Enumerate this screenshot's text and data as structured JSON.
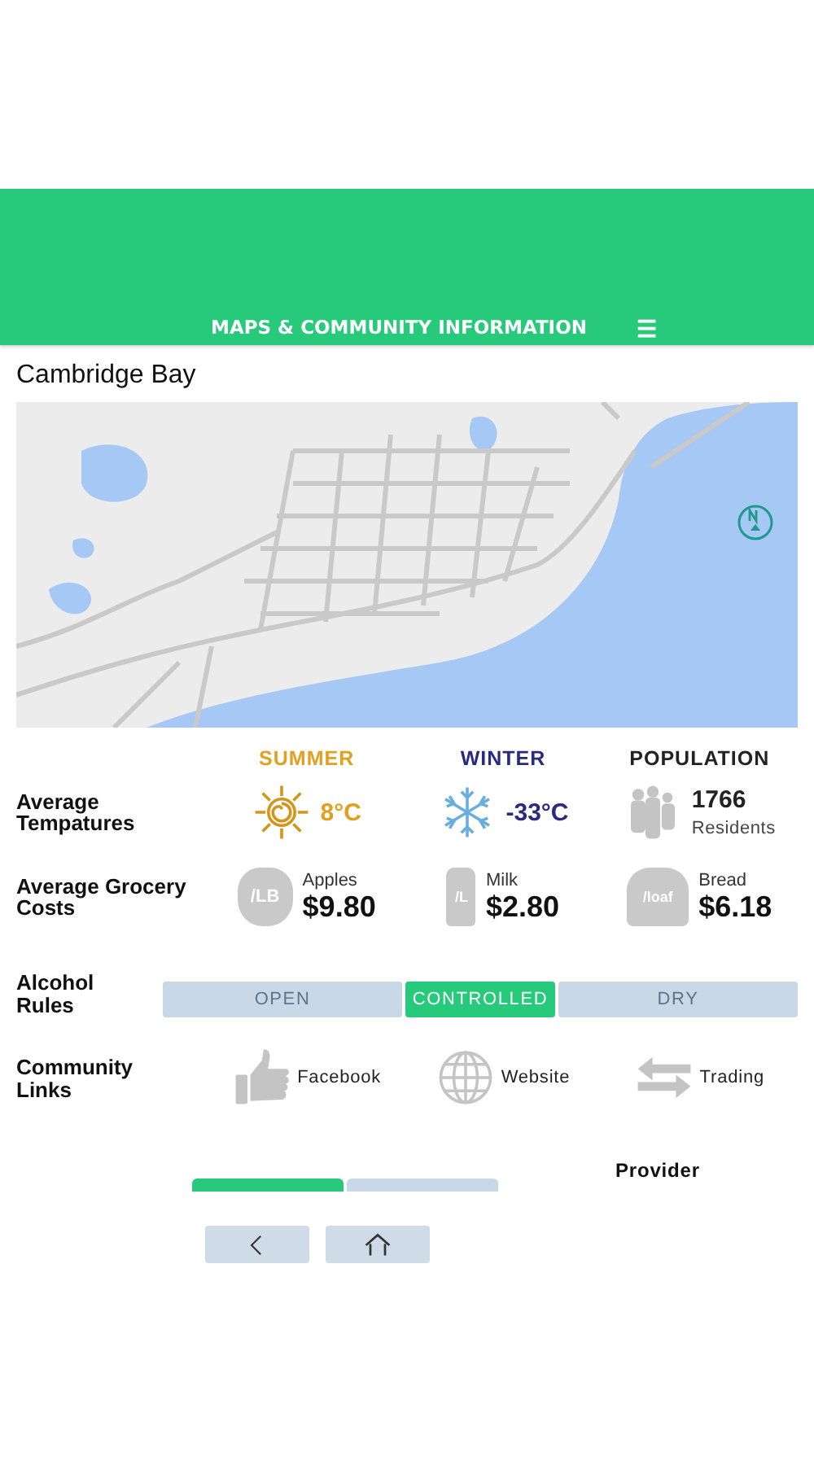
{
  "header": {
    "title": "MAPS & COMMUNITY INFORMATION",
    "menu_icon": "☰"
  },
  "community": {
    "name": "Cambridge Bay"
  },
  "temperatures": {
    "label": "Average Tempatures",
    "columns": [
      {
        "kind": "summer",
        "heading": "SUMMER",
        "value": "8°C",
        "color": "#e0a020"
      },
      {
        "kind": "winter",
        "heading": "WINTER",
        "value": "-33°C",
        "color": "#2a2a80"
      },
      {
        "kind": "population",
        "heading": "POPULATION",
        "value": "1766",
        "unit": "Residents",
        "color": "#222222"
      }
    ]
  },
  "grocery": {
    "label": "Average Grocery Costs",
    "items": [
      {
        "kind": "apple",
        "unit": "/LB",
        "name": "Apples",
        "price": "$9.80"
      },
      {
        "kind": "milk",
        "unit": "/L",
        "name": "Milk",
        "price": "$2.80"
      },
      {
        "kind": "bread",
        "unit": "/loaf",
        "name": "Bread",
        "price": "$6.18"
      }
    ]
  },
  "alcohol": {
    "label": "Alcohol Rules",
    "options": [
      {
        "label": "OPEN",
        "selected": false
      },
      {
        "label": "CONTROLLED",
        "selected": true
      },
      {
        "label": "DRY",
        "selected": false
      }
    ]
  },
  "links": {
    "label": "Community Links",
    "items": [
      {
        "kind": "facebook",
        "label": "Facebook"
      },
      {
        "kind": "website",
        "label": "Website"
      },
      {
        "kind": "trading",
        "label": "Trading"
      }
    ]
  },
  "cellular": {
    "options": [
      {
        "selected": true
      },
      {
        "selected": false
      }
    ],
    "provider_heading": "Provider"
  }
}
